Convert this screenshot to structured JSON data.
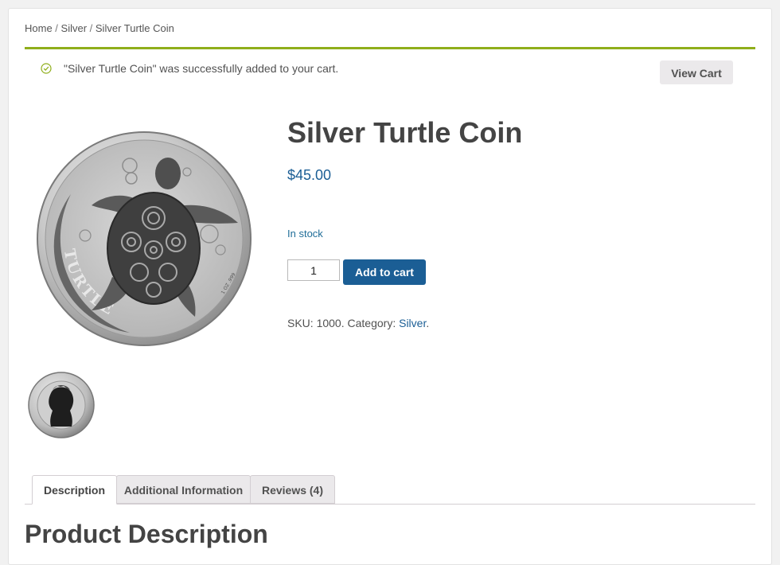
{
  "breadcrumb": {
    "home": "Home",
    "sep1": " / ",
    "category": "Silver",
    "sep2": " / ",
    "current": "Silver Turtle Coin"
  },
  "notice": {
    "icon": "check-circle-icon",
    "message": "\"Silver Turtle Coin\" was successfully added to your cart.",
    "view_cart_label": "View Cart",
    "accent_color": "#8fae1b"
  },
  "product": {
    "title": "Silver Turtle Coin",
    "price": "$45.00",
    "stock": "In stock",
    "quantity": "1",
    "add_to_cart_label": "Add to cart",
    "sku_label": "SKU: ",
    "sku": "1000",
    "category_label": ". Category: ",
    "category": "Silver",
    "category_end": ".",
    "main_image": {
      "icon": "turtle-coin-image",
      "coin_text": "TURTLE"
    },
    "thumbnail": {
      "icon": "coin-reverse-thumbnail"
    }
  },
  "tabs": [
    {
      "label": "Description",
      "active": true
    },
    {
      "label": "Additional Information",
      "active": false
    },
    {
      "label": "Reviews (4)",
      "active": false
    }
  ],
  "content": {
    "heading": "Product Description"
  },
  "colors": {
    "brand_blue": "#1b5e95",
    "notice_green": "#8fae1b"
  }
}
